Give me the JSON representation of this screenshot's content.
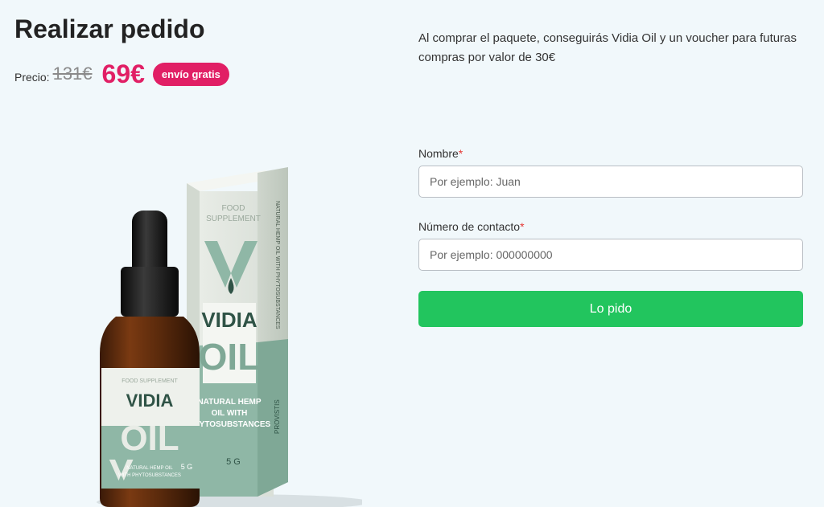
{
  "order": {
    "title": "Realizar pedido",
    "price_label": "Precio:",
    "old_price": "131€",
    "new_price": "69€",
    "shipping_badge": "envío gratis"
  },
  "info": {
    "text": "Al comprar el paquete, conseguirás Vidia Oil y un voucher para futuras compras por valor de 30€"
  },
  "form": {
    "name_label": "Nombre",
    "name_placeholder": "Por ejemplo: Juan",
    "phone_label": "Número de contacto",
    "phone_placeholder": "Por ejemplo: 000000000",
    "required_mark": "*",
    "submit_label": "Lo pido"
  },
  "product": {
    "box_food": "FOOD",
    "box_supplement": "SUPPLEMENT",
    "box_side_text": "NATURAL HEMP OIL WITH PHYTOSUBSTANCES",
    "brand_line1": "VIDIA",
    "brand_line2": "OIL",
    "box_desc1": "NATURAL HEMP",
    "box_desc2": "OIL WITH",
    "box_desc3": "PHYTOSUBSTANCES",
    "box_weight": "5 G",
    "box_provistis": "PROVISTIS",
    "bottle_supplement": "FOOD SUPPLEMENT",
    "bottle_desc1": "NATURAL HEMP OIL",
    "bottle_desc2": "WITH PHYTOSUBSTANCES",
    "bottle_weight": "5 G"
  },
  "colors": {
    "accent_pink": "#e11f65",
    "submit_green": "#22c55e",
    "required_red": "#e53935",
    "product_green": "#8fb7a6"
  }
}
